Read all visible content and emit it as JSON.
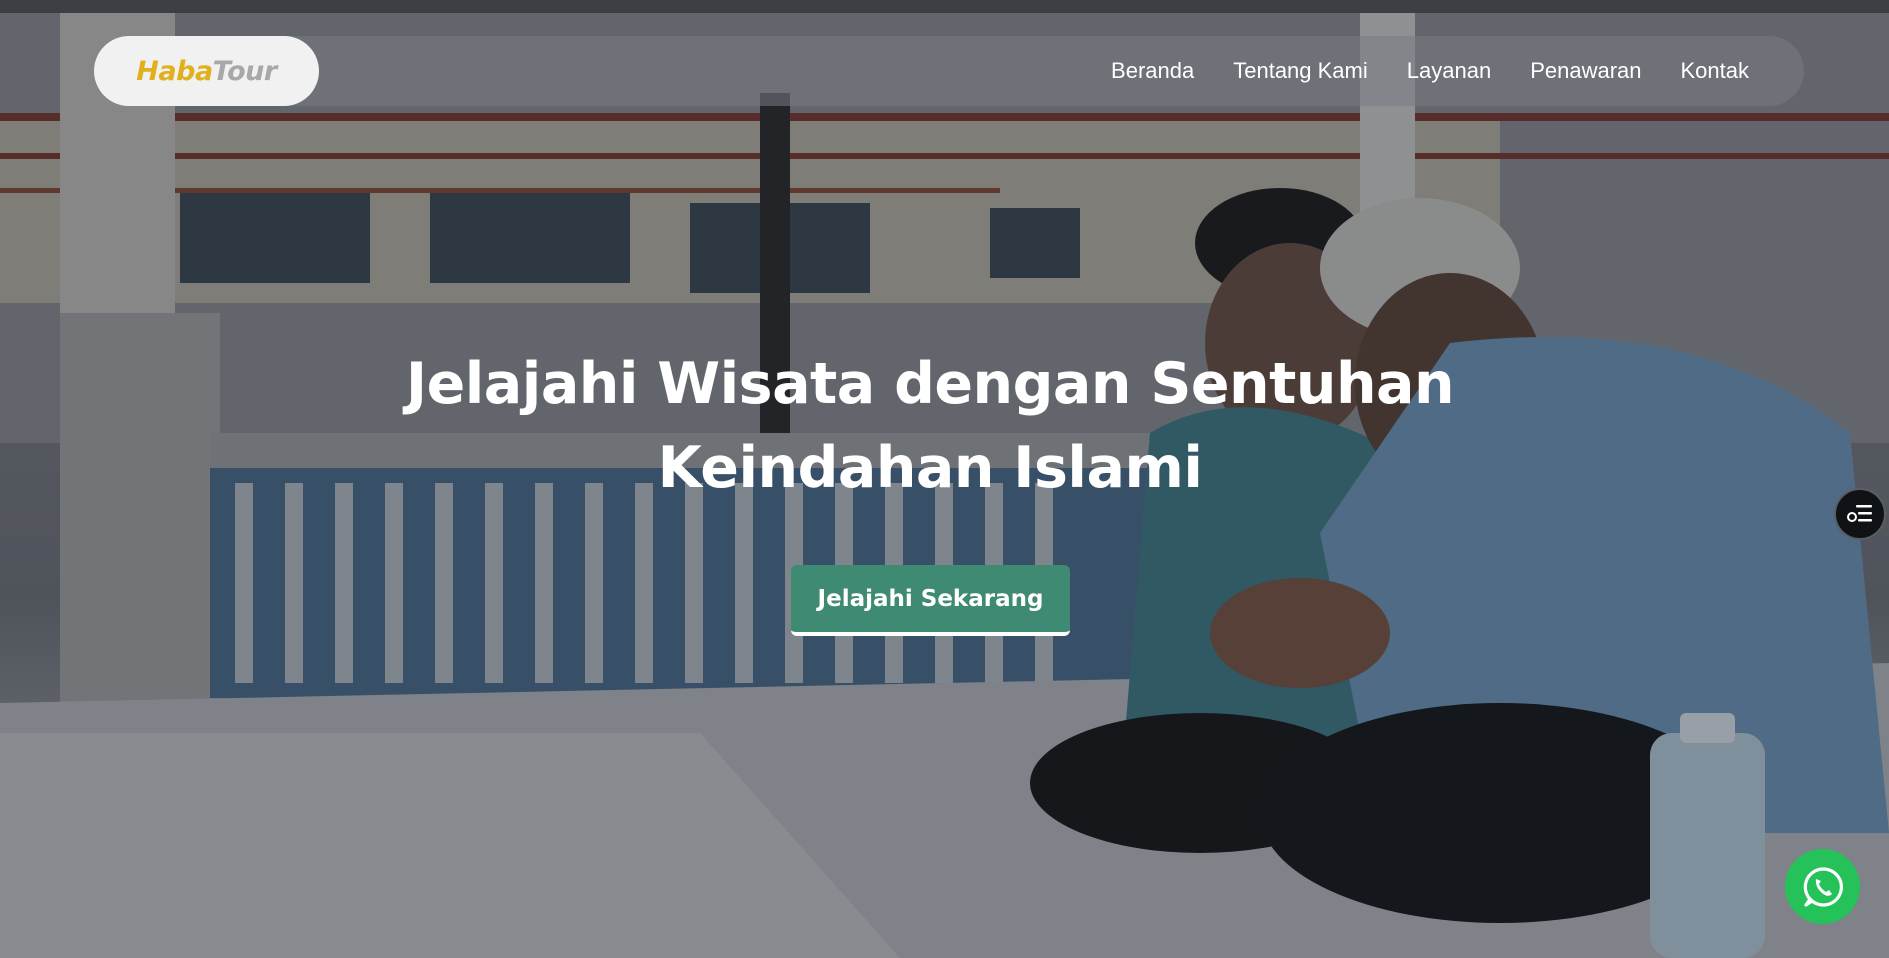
{
  "logo": {
    "part1": "Haba",
    "part2": "Tour"
  },
  "nav": {
    "items": [
      {
        "label": "Beranda"
      },
      {
        "label": "Tentang Kami"
      },
      {
        "label": "Layanan"
      },
      {
        "label": "Penawaran"
      },
      {
        "label": "Kontak"
      }
    ]
  },
  "hero": {
    "title_line1": "Jelajahi Wisata dengan Sentuhan",
    "title_line2": "Keindahan Islami",
    "cta_label": "Jelajahi Sekarang",
    "background_icon": "photo-men-praying-mosque"
  },
  "widgets": {
    "side_icon": "list-settings-icon",
    "whatsapp_icon": "whatsapp-icon"
  },
  "colors": {
    "accent_gold": "#e1b11d",
    "cta_green": "#3e8a72",
    "whatsapp_green": "#25c25a"
  }
}
